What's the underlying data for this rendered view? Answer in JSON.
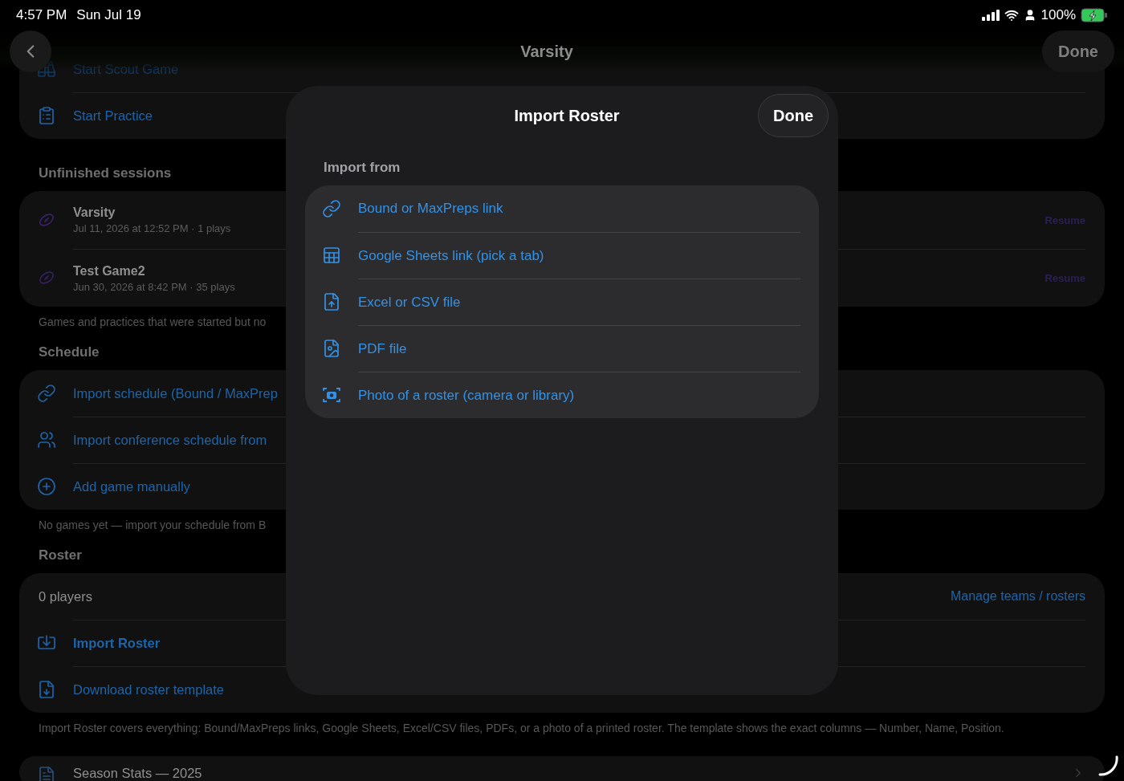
{
  "status_bar": {
    "time": "4:57 PM",
    "date": "Sun Jul 19",
    "battery": "100%",
    "charging": true
  },
  "nav": {
    "title": "Varsity",
    "done": "Done"
  },
  "sections": [
    {
      "rows": [
        {
          "kind": "action",
          "label": "Start Scout Game",
          "emphasis": false,
          "faded": true
        },
        {
          "kind": "action",
          "label": "Start Practice",
          "emphasis": false,
          "faded": false
        }
      ]
    },
    {
      "header": "Unfinished sessions",
      "rows": [
        {
          "kind": "session",
          "title": "Varsity",
          "subtitle": "Jul 11, 2026 at 12:52 PM · 1 plays",
          "action": "Resume"
        },
        {
          "kind": "session",
          "title": "Test Game2",
          "subtitle": "Jun 30, 2026 at 8:42 PM · 35 plays",
          "action": "Resume"
        }
      ],
      "footer": "Games and practices that were started but no"
    },
    {
      "header": "Schedule",
      "rows": [
        {
          "kind": "action",
          "label": "Import schedule (Bound / MaxPrep",
          "emphasis": false,
          "faded": false
        },
        {
          "kind": "action",
          "label": "Import conference schedule from",
          "emphasis": false,
          "faded": false
        },
        {
          "kind": "action",
          "label": "Add game manually",
          "emphasis": false,
          "faded": false
        }
      ],
      "footer": "No games yet — import your schedule from B"
    },
    {
      "header": "Roster",
      "rows": [
        {
          "kind": "info",
          "label": "0 players",
          "link": "Manage teams / rosters"
        },
        {
          "kind": "action",
          "label": "Import Roster",
          "emphasis": true,
          "faded": false
        },
        {
          "kind": "action",
          "label": "Download roster template",
          "emphasis": false,
          "faded": false
        }
      ],
      "footer": "Import Roster covers everything: Bound/MaxPreps links, Google Sheets, Excel/CSV files, PDFs, or a photo of a printed roster. The template shows the exact columns — Number, Name, Position."
    },
    {
      "rows": [
        {
          "kind": "nav",
          "label": "Season Stats — 2025"
        }
      ]
    }
  ],
  "modal": {
    "title": "Import Roster",
    "done": "Done",
    "group_label": "Import from",
    "options": [
      "Bound or MaxPreps link",
      "Google Sheets link (pick a tab)",
      "Excel or CSV file",
      "PDF file",
      "Photo of a roster (camera or library)"
    ]
  }
}
